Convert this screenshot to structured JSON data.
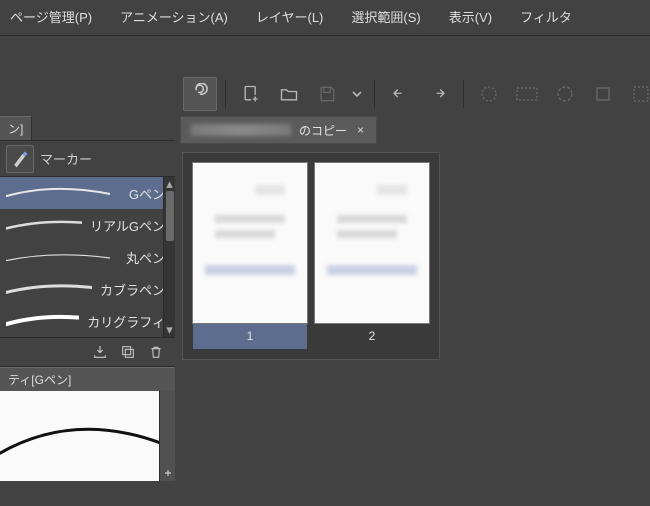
{
  "menubar": {
    "items": [
      {
        "label": "ページ管理(P)"
      },
      {
        "label": "アニメーション(A)"
      },
      {
        "label": "レイヤー(L)"
      },
      {
        "label": "選択範囲(S)"
      },
      {
        "label": "表示(V)"
      },
      {
        "label": "フィルタ"
      }
    ]
  },
  "toolbar": {
    "icons": [
      "spiral-icon",
      "new-file-icon",
      "open-folder-icon",
      "save-icon",
      "dropdown-icon",
      "undo-icon",
      "redo-icon",
      "select-dashed-icon",
      "gradient-icon",
      "dashed-circle-icon",
      "crop-icon",
      "marquee-icon"
    ]
  },
  "document": {
    "tab_suffix": "のコピー",
    "close_glyph": "×"
  },
  "pages": {
    "items": [
      {
        "num": "1",
        "selected": true
      },
      {
        "num": "2",
        "selected": false
      }
    ]
  },
  "left": {
    "tool_tab_suffix": "ン]",
    "marker_label": "マーカー",
    "pens": [
      {
        "label": "Gペン",
        "selected": true,
        "badge": "G"
      },
      {
        "label": "リアルGペン"
      },
      {
        "label": "丸ペン"
      },
      {
        "label": "カブラペン"
      },
      {
        "label": "カリグラフィ"
      }
    ],
    "property_header": "ティ[Gペン]"
  }
}
